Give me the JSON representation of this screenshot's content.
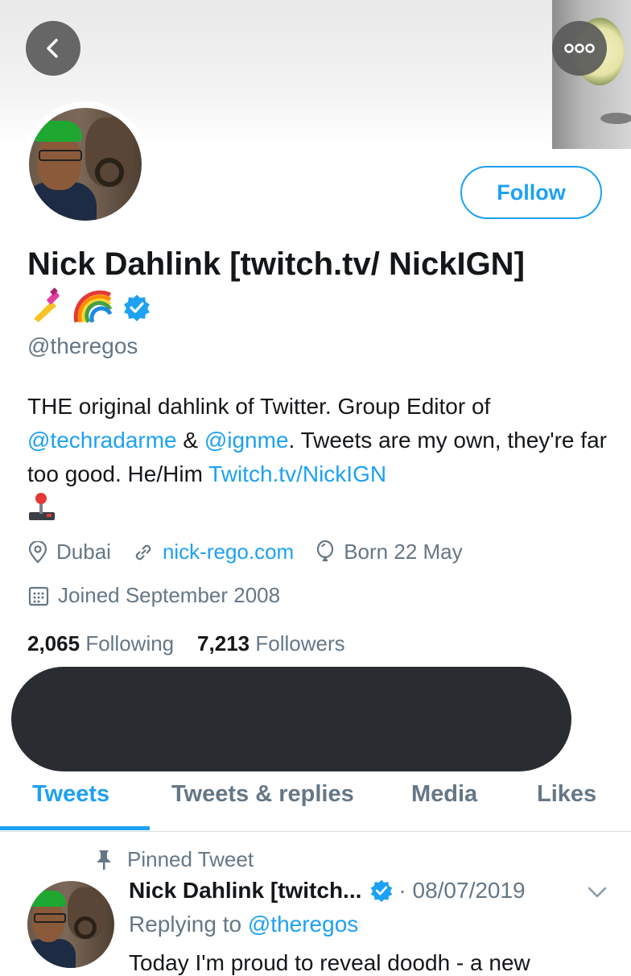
{
  "profile": {
    "name": "Nick Dahlink [twitch.tv/ NickIGN]",
    "verified": true,
    "handle": "@theregos",
    "follow_label": "Follow",
    "bio": {
      "part1": "THE original dahlink of Twitter. Group Editor of ",
      "mention1": "@techradarme",
      "amp": " & ",
      "mention2": "@ignme",
      "part2": ". Tweets are my own, they're far too good. He/Him ",
      "link": "Twitch.tv/NickIGN"
    },
    "location": "Dubai",
    "website": "nick-rego.com",
    "birthday": "Born 22 May",
    "joined": "Joined September 2008"
  },
  "stats": {
    "following_count": "2,065",
    "following_label": "Following",
    "followers_count": "7,213",
    "followers_label": "Followers"
  },
  "tabs": [
    {
      "label": "Tweets",
      "active": true
    },
    {
      "label": "Tweets & replies",
      "active": false
    },
    {
      "label": "Media",
      "active": false
    },
    {
      "label": "Likes",
      "active": false
    }
  ],
  "tweet": {
    "pinned_label": "Pinned Tweet",
    "author": "Nick Dahlink [twitch...",
    "date": "· 08/07/2019",
    "replying_prefix": "Replying to ",
    "replying_handle": "@theregos",
    "text_preview": "Today I'm proud to reveal doodh - a new"
  },
  "colors": {
    "accent": "#1da1f2",
    "muted": "#657786",
    "text": "#14171a",
    "redaction": "#292d32"
  },
  "icons": [
    "back-arrow-icon",
    "more-dots-icon",
    "verified-badge-icon",
    "location-icon",
    "link-icon",
    "balloon-icon",
    "calendar-icon",
    "pin-icon",
    "chevron-down-icon",
    "nail-polish-emoji",
    "rainbow-emoji",
    "joystick-emoji"
  ]
}
